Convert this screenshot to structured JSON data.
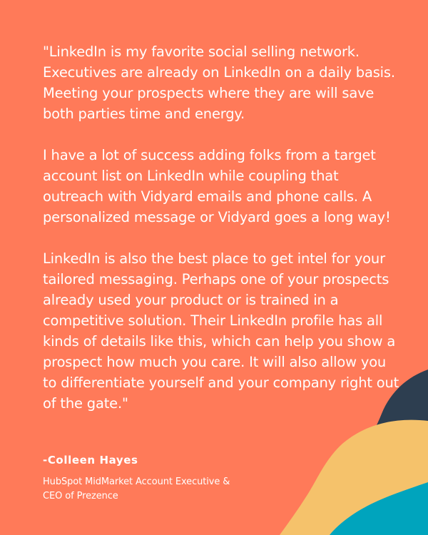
{
  "colors": {
    "background": "#FF7A59",
    "text": "#FFFFFF",
    "navy_blob": "#2D3E50",
    "yellow_blob": "#F5C26B",
    "teal_blob": "#00A4BD"
  },
  "quote": {
    "paragraphs": [
      "\"LinkedIn is my favorite social selling network. Executives are already on LinkedIn on a daily basis. Meeting your prospects where they are will save both parties time and energy.",
      "I have a lot of success adding folks from a target account list on LinkedIn while coupling that outreach with Vidyard emails and phone calls. A personalized message or Vidyard goes a long way!",
      "LinkedIn is also the best place to get intel for your tailored messaging. Perhaps one of your prospects already used your product or is trained in a competitive solution. Their LinkedIn profile has all kinds of details like this, which can help you show a prospect how much you care. It will also allow you to differentiate yourself and your company right out of the gate.\""
    ]
  },
  "attribution": {
    "name": "-Colleen Hayes",
    "role_line_1": "HubSpot MidMarket Account Executive &",
    "role_line_2": "CEO of Prezence"
  }
}
